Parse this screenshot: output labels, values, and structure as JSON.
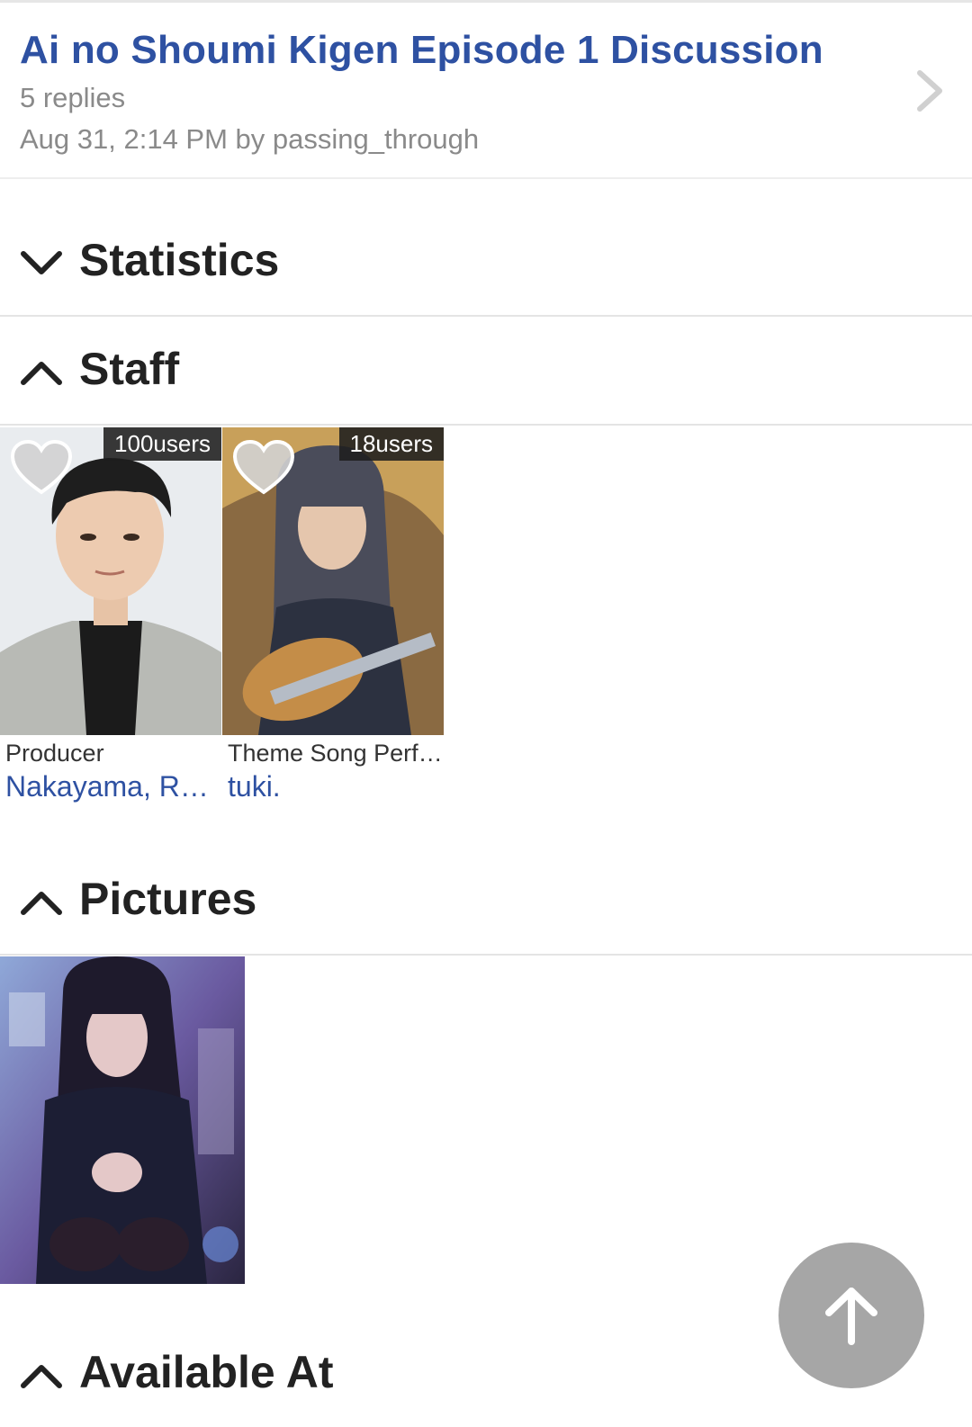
{
  "topic": {
    "title": "Ai no Shoumi Kigen Episode 1 Discussion",
    "replies": "5 replies",
    "meta": "Aug 31, 2:14 PM by passing_through"
  },
  "sections": {
    "statistics": "Statistics",
    "staff": "Staff",
    "pictures": "Pictures",
    "available_at": "Available At"
  },
  "staff": [
    {
      "role": "Producer",
      "name": "Nakayama, R…",
      "favorites": "100users"
    },
    {
      "role": "Theme Song Perf…",
      "name": "tuki.",
      "favorites": "18users"
    }
  ],
  "colors": {
    "link": "#2e51a2",
    "fab": "#a6a6a6"
  }
}
